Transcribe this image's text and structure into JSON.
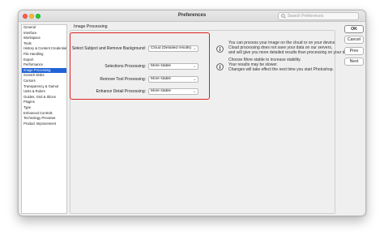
{
  "window": {
    "title": "Preferences",
    "search_placeholder": "Search Preferences"
  },
  "sidebar": {
    "items": [
      {
        "label": "General"
      },
      {
        "label": "Interface"
      },
      {
        "label": "Workspace"
      },
      {
        "label": "Tools"
      },
      {
        "label": "History & Content Credentials"
      },
      {
        "label": "File Handling"
      },
      {
        "label": "Export"
      },
      {
        "label": "Performance"
      },
      {
        "label": "Image Processing",
        "selected": true
      },
      {
        "label": "Scratch Disks"
      },
      {
        "label": "Cursors"
      },
      {
        "label": "Transparency & Gamut"
      },
      {
        "label": "Units & Rulers"
      },
      {
        "label": "Guides, Grid & Slices"
      },
      {
        "label": "Plugins"
      },
      {
        "label": "Type"
      },
      {
        "label": "Enhanced Controls"
      },
      {
        "label": "Technology Previews"
      },
      {
        "label": "Product Improvement"
      }
    ]
  },
  "panel": {
    "group_title": "Image Processing",
    "rows": [
      {
        "label": "Select Subject and Remove Background:",
        "value": "Cloud (Detailed results)"
      },
      {
        "label": "Selections Processing:",
        "value": "More stable"
      },
      {
        "label": "Remove Tool Processing:",
        "value": "More stable"
      },
      {
        "label": "Enhance Detail Processing:",
        "value": "More stable"
      }
    ],
    "info1": [
      "You can process your image on the cloud or on your device.",
      "Cloud processing does not save your data on our servers,",
      "and will give you more detailed results than processing on your device."
    ],
    "info2": [
      "Choose More stable to increase stability.",
      "Your results may be slower.",
      "Changes will take effect the next time you start Photoshop."
    ],
    "info_icon": "info-circle-icon",
    "highlight_color": "#e02020"
  },
  "buttons": {
    "ok": "OK",
    "cancel": "Cancel",
    "prev": "Prev",
    "next": "Next"
  }
}
